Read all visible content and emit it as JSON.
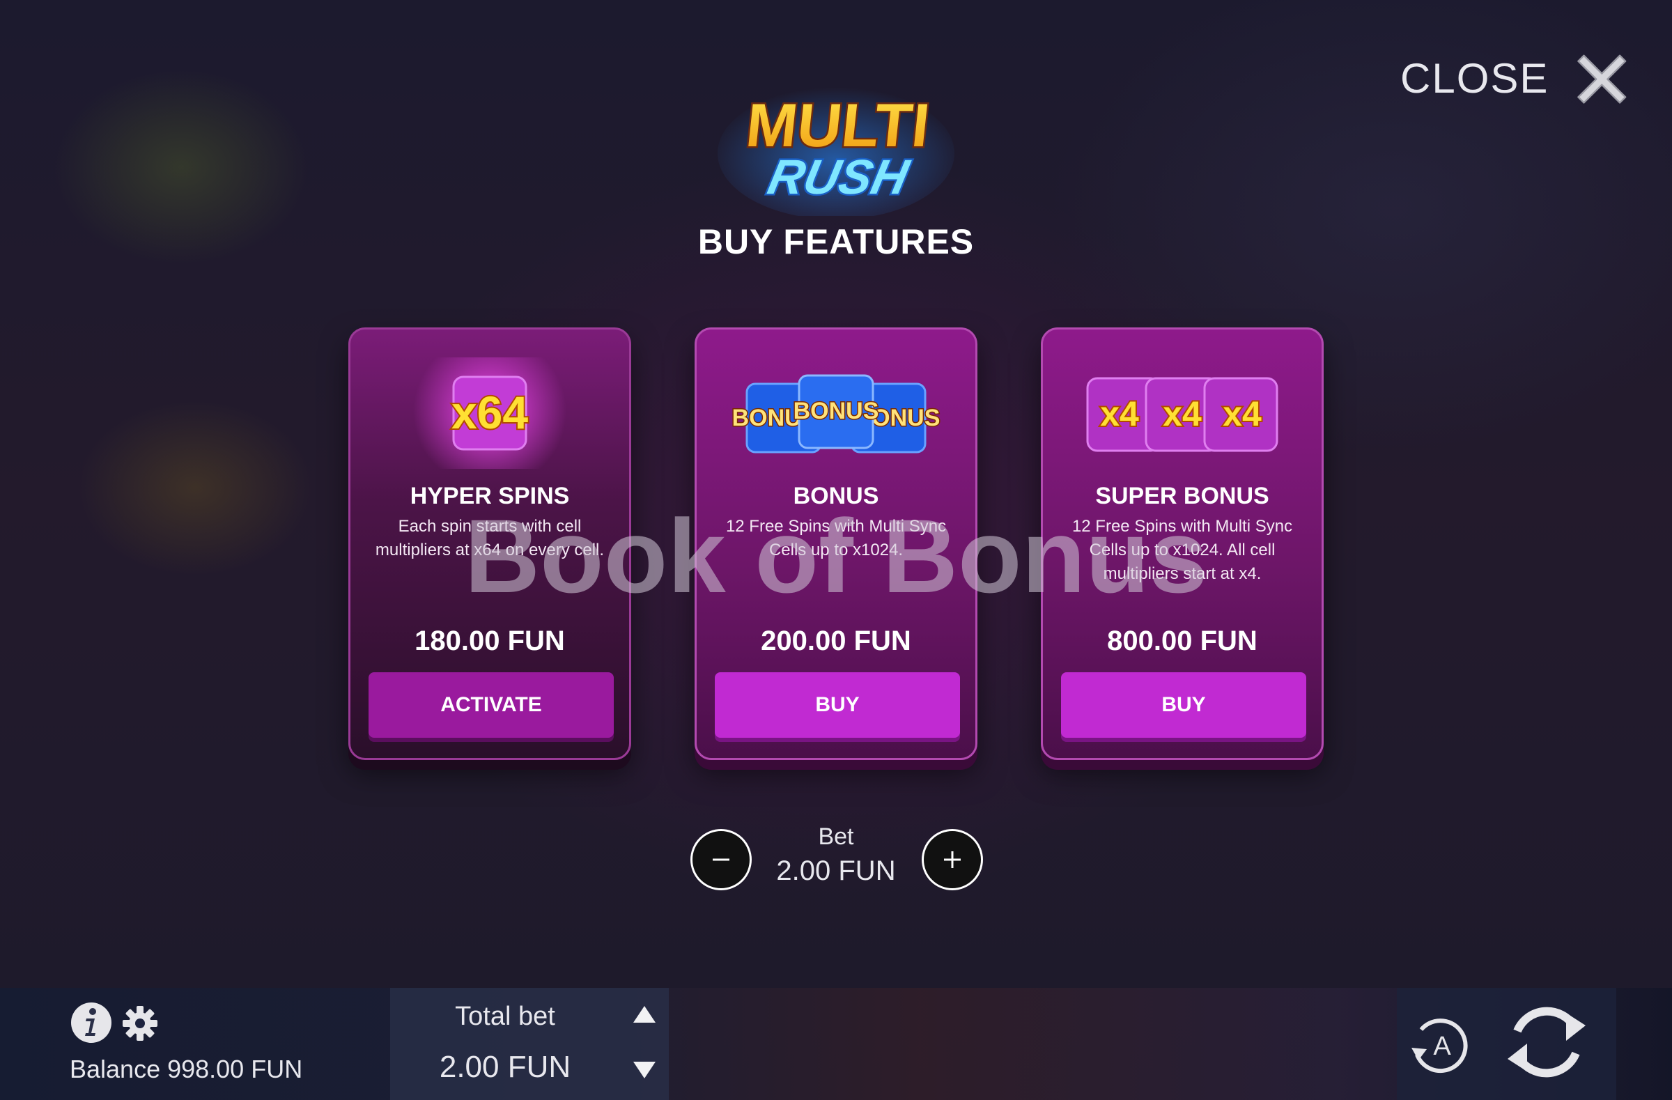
{
  "header": {
    "close_label": "CLOSE",
    "logo_line1": "MULTI",
    "logo_line2": "RUSH",
    "title": "BUY FEATURES"
  },
  "cards": [
    {
      "art_text": "x64",
      "title": "HYPER SPINS",
      "description": "Each spin starts with cell multipliers at x64 on every cell.",
      "price": "180.00 FUN",
      "button": "ACTIVATE"
    },
    {
      "art_text": "BONUS",
      "title": "BONUS",
      "description": "12 Free Spins with Multi Sync Cells up to x1024.",
      "price": "200.00 FUN",
      "button": "BUY"
    },
    {
      "art_text": "x4",
      "title": "SUPER BONUS",
      "description": "12 Free Spins with Multi Sync Cells up to x1024. All cell multipliers start at x4.",
      "price": "800.00 FUN",
      "button": "BUY"
    }
  ],
  "watermark": "Book of Bonus",
  "bet": {
    "label": "Bet",
    "value": "2.00 FUN"
  },
  "bottom_bar": {
    "balance": "Balance 998.00 FUN",
    "total_bet_label": "Total bet",
    "total_bet_value": "2.00 FUN"
  },
  "colors": {
    "card_purple": "#8e1a8b",
    "button_magenta": "#c12ad2",
    "logo_gold": "#f5c21a",
    "logo_cyan": "#3fd0f5"
  }
}
